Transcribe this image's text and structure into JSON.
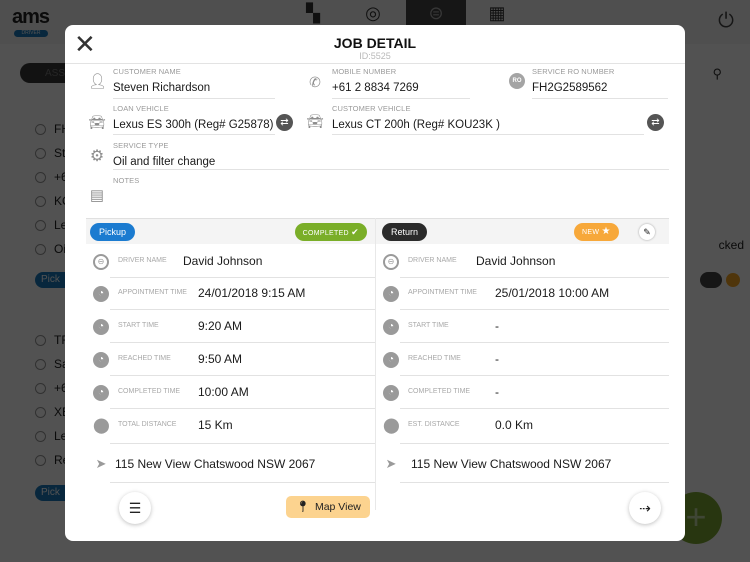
{
  "background": {
    "logo_text": "ams",
    "logo_badge": "DRIVER",
    "nav_tabs": [
      {
        "icon": "dashboard-icon",
        "glyph": "▚"
      },
      {
        "icon": "steering-wheel-icon",
        "glyph": "◎"
      },
      {
        "icon": "car-icon",
        "glyph": "⊜"
      },
      {
        "icon": "calendar-icon",
        "glyph": "▦"
      }
    ],
    "power_glyph": "⏻",
    "filter_pill": "ASS",
    "search_glyph": "⚲",
    "cards": [
      {
        "lines": [
          "FH",
          "St",
          "+6",
          "KO",
          "Le",
          "Oi"
        ],
        "pill": "Pick"
      },
      {
        "lines": [
          "TF",
          "Sa",
          "+6",
          "XE",
          "Le",
          "Re"
        ],
        "pill": "Pick"
      }
    ],
    "checked_text": "cked",
    "fab_glyph": "+"
  },
  "modal": {
    "title": "JOB DETAIL",
    "id_text": "ID:5525",
    "close_glyph": "✕",
    "customer_name": {
      "label": "CUSTOMER NAME",
      "value": "Steven Richardson"
    },
    "mobile_number": {
      "label": "MOBILE NUMBER",
      "value": "+61 2 8834 7269"
    },
    "service_ro_number": {
      "label": "SERVICE RO NUMBER",
      "value": "FH2G2589562",
      "badge": "RO"
    },
    "loan_vehicle": {
      "label": "LOAN VEHICLE",
      "value": "Lexus ES 300h (Reg# G25878)"
    },
    "customer_vehicle": {
      "label": "CUSTOMER VEHICLE",
      "value": "Lexus CT 200h (Reg# KOU23K )"
    },
    "service_type": {
      "label": "SERVICE TYPE",
      "value": "Oil and filter change"
    },
    "notes": {
      "label": "NOTES",
      "value": ""
    },
    "pickup": {
      "pill": "Pickup",
      "pill_color": "#1b7bd0",
      "status": "COMPLETED",
      "status_color": "#7aae28",
      "rows": [
        {
          "label": "DRIVER NAME",
          "value": "David Johnson"
        },
        {
          "label": "APPOINTMENT TIME",
          "value": "24/01/2018 9:15 AM"
        },
        {
          "label": "START TIME",
          "value": "9:20 AM"
        },
        {
          "label": "REACHED TIME",
          "value": "9:50 AM"
        },
        {
          "label": "COMPLETED TIME",
          "value": "10:00 AM"
        },
        {
          "label": "TOTAL DISTANCE",
          "value": "15 Km"
        }
      ],
      "address": "115 New View Chatswood NSW 2067",
      "map_button": "Map View"
    },
    "return": {
      "pill": "Return",
      "pill_color": "#2b2b2b",
      "status": "NEW",
      "status_color": "#f7a83a",
      "rows": [
        {
          "label": "DRIVER NAME",
          "value": "David Johnson"
        },
        {
          "label": "APPOINTMENT TIME",
          "value": "25/01/2018 10:00 AM"
        },
        {
          "label": "START TIME",
          "value": "-"
        },
        {
          "label": "REACHED TIME",
          "value": "-"
        },
        {
          "label": "COMPLETED TIME",
          "value": "-"
        },
        {
          "label": "EST. DISTANCE",
          "value": "0.0 Km"
        }
      ],
      "address": "115 New View Chatswood NSW 2067"
    }
  }
}
